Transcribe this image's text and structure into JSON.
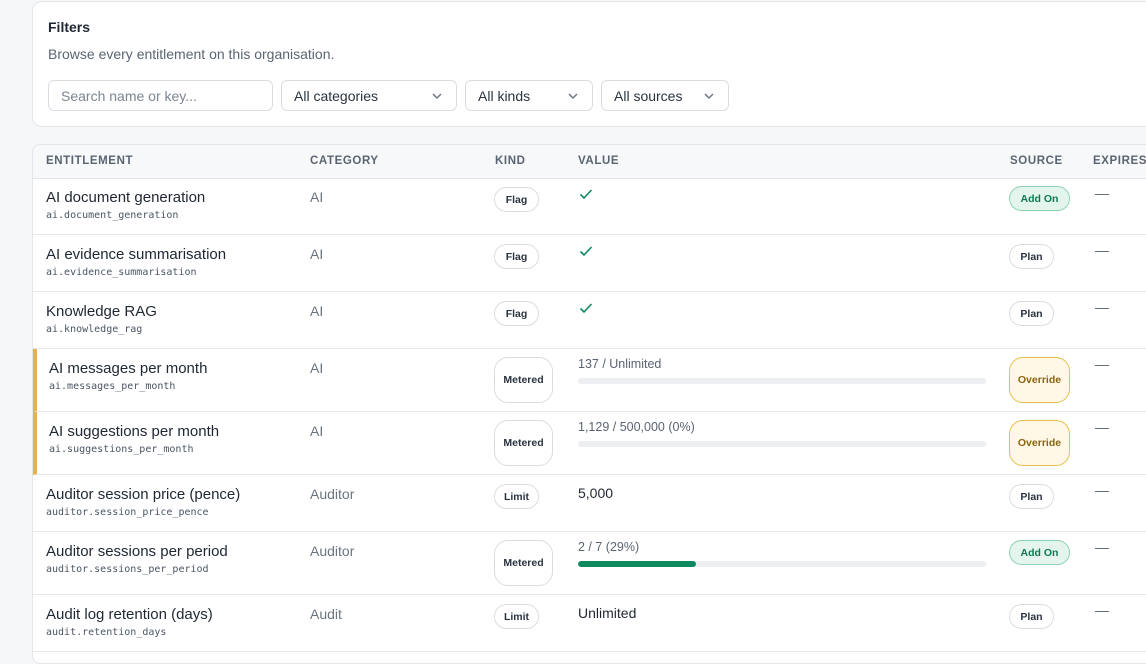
{
  "filters": {
    "title": "Filters",
    "subtitle": "Browse every entitlement on this organisation.",
    "search_placeholder": "Search name or key...",
    "category_select": "All categories",
    "kind_select": "All kinds",
    "source_select": "All sources"
  },
  "table": {
    "headers": {
      "entitlement": "ENTITLEMENT",
      "category": "CATEGORY",
      "kind": "KIND",
      "value": "VALUE",
      "source": "SOURCE",
      "expires": "EXPIRES"
    },
    "rows": [
      {
        "name": "AI document generation",
        "key": "ai.document_generation",
        "category": "AI",
        "kind": "Flag",
        "value_type": "check",
        "source": "Add On",
        "expires": "—"
      },
      {
        "name": "AI evidence summarisation",
        "key": "ai.evidence_summarisation",
        "category": "AI",
        "kind": "Flag",
        "value_type": "check",
        "source": "Plan",
        "expires": "—"
      },
      {
        "name": "Knowledge RAG",
        "key": "ai.knowledge_rag",
        "category": "AI",
        "kind": "Flag",
        "value_type": "check",
        "source": "Plan",
        "expires": "—"
      },
      {
        "name": "AI messages per month",
        "key": "ai.messages_per_month",
        "category": "AI",
        "kind": "Metered",
        "value": "137 / Unlimited",
        "usage_fraction": 0,
        "source": "Override",
        "expires": "—"
      },
      {
        "name": "AI suggestions per month",
        "key": "ai.suggestions_per_month",
        "category": "AI",
        "kind": "Metered",
        "value": "1,129 / 500,000 (0%)",
        "usage_fraction": 0,
        "source": "Override",
        "expires": "—"
      },
      {
        "name": "Auditor session price (pence)",
        "key": "auditor.session_price_pence",
        "category": "Auditor",
        "kind": "Limit",
        "value": "5,000",
        "source": "Plan",
        "expires": "—"
      },
      {
        "name": "Auditor sessions per period",
        "key": "auditor.sessions_per_period",
        "category": "Auditor",
        "kind": "Metered",
        "value": "2 / 7 (29%)",
        "usage_fraction": 0.29,
        "source": "Add On",
        "expires": "—"
      },
      {
        "name": "Audit log retention (days)",
        "key": "audit.retention_days",
        "category": "Audit",
        "kind": "Limit",
        "value": "Unlimited",
        "source": "Plan",
        "expires": "—"
      }
    ]
  },
  "colors": {
    "override_accent": "#e8b04b",
    "addon_green": "#0f8a5f",
    "meter_fill": "#0f8a5f"
  },
  "icons": {
    "value_check": "check-icon",
    "select_chevron": "chevron-down-icon"
  }
}
